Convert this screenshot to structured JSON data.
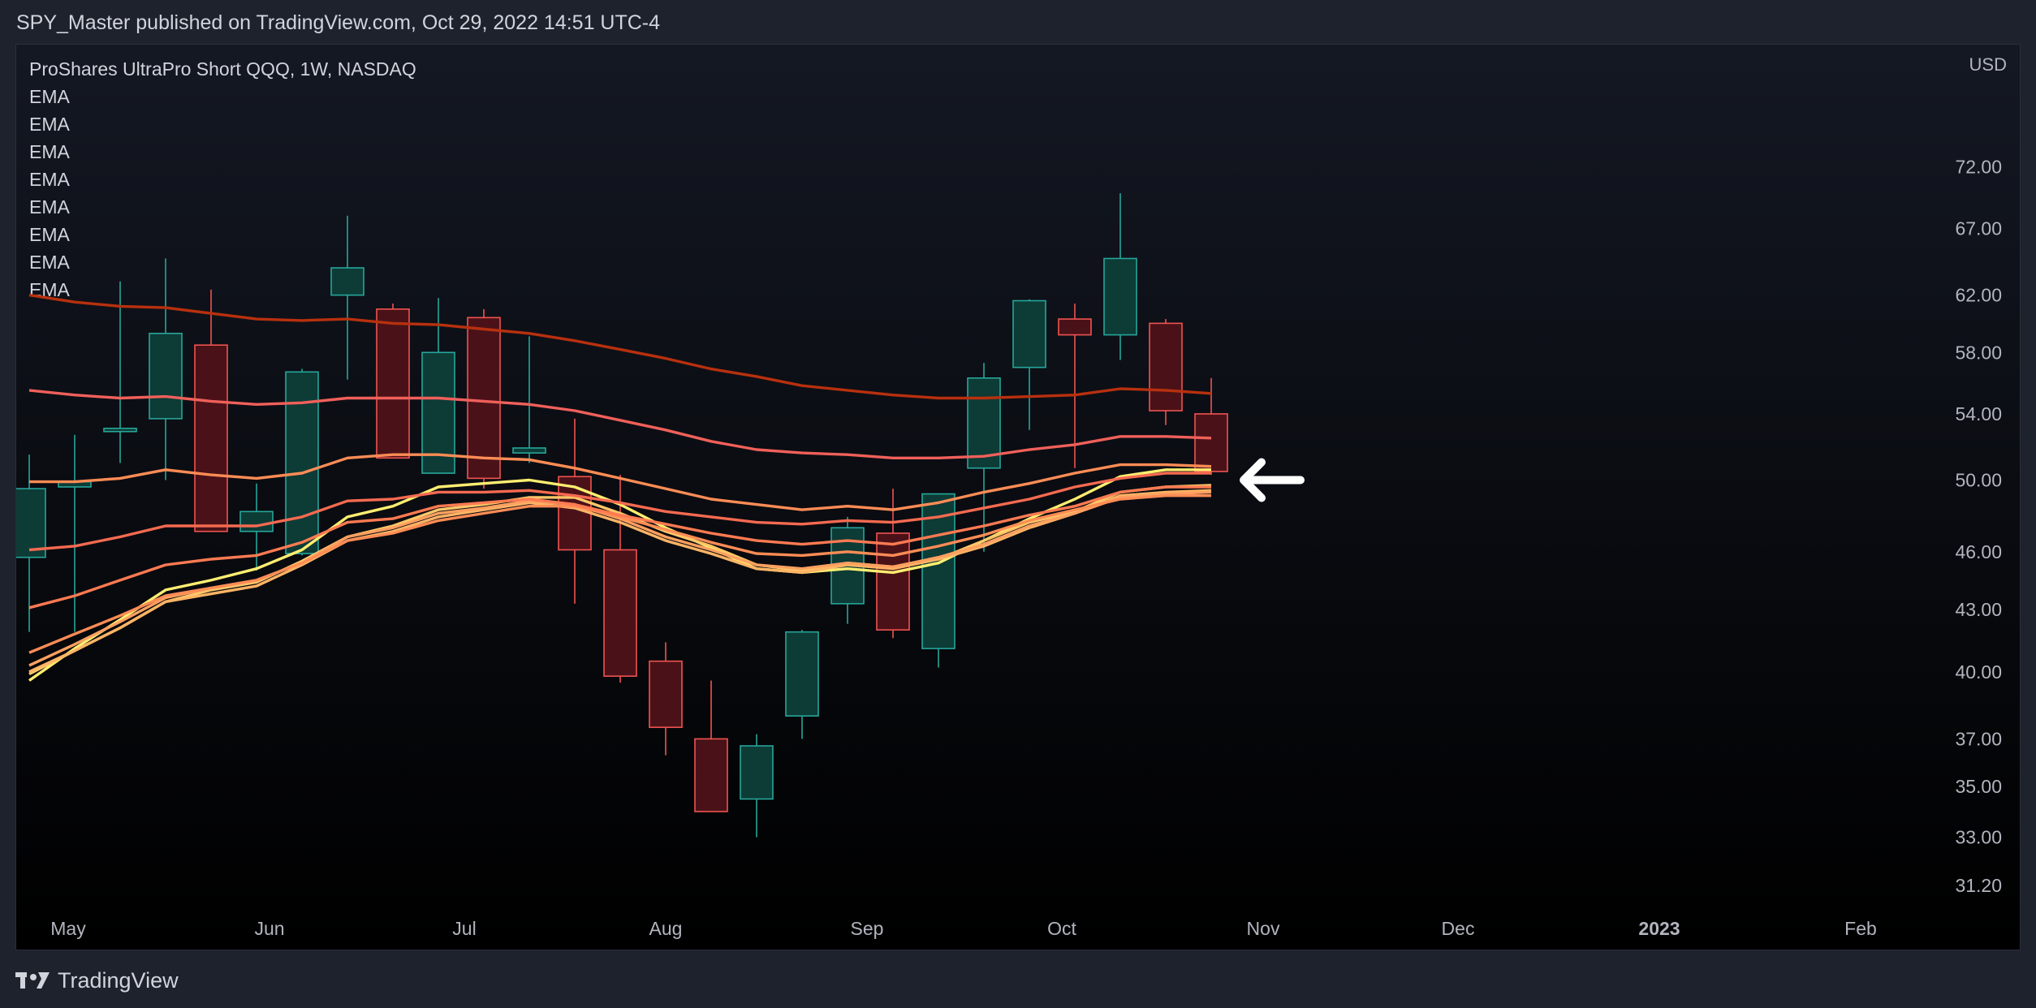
{
  "header": {
    "text": "SPY_Master published on TradingView.com, Oct 29, 2022 14:51 UTC-4"
  },
  "footer": {
    "brand": "TradingView"
  },
  "colors": {
    "up": "#26a69a",
    "up_fill": "#0d3b36",
    "down": "#ef5350",
    "down_fill": "#4a1218",
    "text": "#d1d4dc",
    "axis_text": "#b2b5be",
    "ema": [
      "#ffeb70",
      "#ffc060",
      "#ffb060",
      "#ff9e58",
      "#ff8a50",
      "#ff7550",
      "#f05a4e",
      "#b02a10"
    ]
  },
  "chart_data": {
    "type": "candlestick",
    "symbol_label": "ProShares UltraPro Short QQQ, 1W, NASDAQ",
    "currency": "USD",
    "indicator_labels": [
      "EMA",
      "EMA",
      "EMA",
      "EMA",
      "EMA",
      "EMA",
      "EMA",
      "EMA"
    ],
    "y_ticks": [
      72.0,
      67.0,
      62.0,
      58.0,
      54.0,
      50.0,
      46.0,
      43.0,
      40.0,
      37.0,
      35.0,
      33.0,
      31.2
    ],
    "y_scale": "log",
    "ylim": [
      30.5,
      75.5
    ],
    "x_labels": [
      {
        "label": "May",
        "date": "2022-05-01",
        "bold": false
      },
      {
        "label": "Jun",
        "date": "2022-06-01",
        "bold": false
      },
      {
        "label": "Jul",
        "date": "2022-07-01",
        "bold": false
      },
      {
        "label": "Aug",
        "date": "2022-08-01",
        "bold": false
      },
      {
        "label": "Sep",
        "date": "2022-09-01",
        "bold": false
      },
      {
        "label": "Oct",
        "date": "2022-10-01",
        "bold": false
      },
      {
        "label": "Nov",
        "date": "2022-11-01",
        "bold": false
      },
      {
        "label": "Dec",
        "date": "2022-12-01",
        "bold": false
      },
      {
        "label": "2023",
        "date": "2023-01-01",
        "bold": true
      },
      {
        "label": "Feb",
        "date": "2023-02-01",
        "bold": false
      }
    ],
    "candles": [
      {
        "date": "2022-04-25",
        "o": 45.7,
        "h": 51.5,
        "l": 41.9,
        "c": 49.5
      },
      {
        "date": "2022-05-02",
        "o": 49.6,
        "h": 52.7,
        "l": 41.9,
        "c": 49.9
      },
      {
        "date": "2022-05-09",
        "o": 52.9,
        "h": 63.0,
        "l": 51.0,
        "c": 53.1
      },
      {
        "date": "2022-05-16",
        "o": 53.7,
        "h": 64.7,
        "l": 50.0,
        "c": 59.3
      },
      {
        "date": "2022-05-23",
        "o": 58.5,
        "h": 62.4,
        "l": 47.1,
        "c": 47.1
      },
      {
        "date": "2022-05-30",
        "o": 47.1,
        "h": 49.8,
        "l": 45.0,
        "c": 48.2
      },
      {
        "date": "2022-06-06",
        "o": 45.9,
        "h": 56.9,
        "l": 45.8,
        "c": 56.7
      },
      {
        "date": "2022-06-13",
        "o": 62.0,
        "h": 68.0,
        "l": 56.2,
        "c": 64.0
      },
      {
        "date": "2022-06-20",
        "o": 61.0,
        "h": 61.4,
        "l": 51.3,
        "c": 51.3
      },
      {
        "date": "2022-06-27",
        "o": 50.4,
        "h": 61.8,
        "l": 50.4,
        "c": 58.0
      },
      {
        "date": "2022-07-04",
        "o": 60.4,
        "h": 61.0,
        "l": 49.5,
        "c": 50.1
      },
      {
        "date": "2022-07-11",
        "o": 51.6,
        "h": 59.1,
        "l": 51.0,
        "c": 51.9
      },
      {
        "date": "2022-07-18",
        "o": 50.2,
        "h": 53.7,
        "l": 43.3,
        "c": 46.1
      },
      {
        "date": "2022-07-25",
        "o": 46.1,
        "h": 50.3,
        "l": 39.5,
        "c": 39.8
      },
      {
        "date": "2022-08-01",
        "o": 40.5,
        "h": 41.4,
        "l": 36.3,
        "c": 37.5
      },
      {
        "date": "2022-08-08",
        "o": 37.0,
        "h": 39.6,
        "l": 34.0,
        "c": 34.0
      },
      {
        "date": "2022-08-15",
        "o": 34.5,
        "h": 37.2,
        "l": 33.0,
        "c": 36.7
      },
      {
        "date": "2022-08-22",
        "o": 38.0,
        "h": 42.0,
        "l": 37.0,
        "c": 41.9
      },
      {
        "date": "2022-08-29",
        "o": 43.3,
        "h": 47.9,
        "l": 42.3,
        "c": 47.3
      },
      {
        "date": "2022-09-05",
        "o": 47.0,
        "h": 49.5,
        "l": 41.6,
        "c": 42.0
      },
      {
        "date": "2022-09-12",
        "o": 41.1,
        "h": 49.2,
        "l": 40.2,
        "c": 49.2
      },
      {
        "date": "2022-09-19",
        "o": 50.7,
        "h": 57.3,
        "l": 46.0,
        "c": 56.3
      },
      {
        "date": "2022-09-26",
        "o": 57.0,
        "h": 61.7,
        "l": 53.0,
        "c": 61.6
      },
      {
        "date": "2022-10-03",
        "o": 60.3,
        "h": 61.4,
        "l": 50.7,
        "c": 59.2
      },
      {
        "date": "2022-10-10",
        "o": 59.2,
        "h": 69.8,
        "l": 57.5,
        "c": 64.7
      },
      {
        "date": "2022-10-17",
        "o": 60.0,
        "h": 60.3,
        "l": 53.3,
        "c": 54.2
      },
      {
        "date": "2022-10-24",
        "o": 54.0,
        "h": 56.3,
        "l": 50.3,
        "c": 50.5
      }
    ],
    "ema_lines": [
      {
        "values": [
          39.6,
          41.1,
          42.5,
          44.0,
          44.5,
          45.1,
          46.1,
          47.9,
          48.5,
          49.6,
          49.8,
          50.0,
          49.6,
          48.6,
          47.3,
          46.2,
          45.1,
          44.9,
          45.1,
          44.9,
          45.4,
          46.6,
          47.8,
          48.9,
          50.2,
          50.6,
          50.6
        ]
      },
      {
        "values": [
          39.9,
          41.0,
          42.1,
          43.4,
          44.0,
          44.4,
          45.5,
          46.8,
          47.4,
          48.3,
          48.6,
          49.0,
          49.0,
          48.1,
          47.1,
          46.3,
          45.3,
          45.0,
          45.4,
          45.2,
          45.6,
          46.6,
          47.6,
          48.2,
          49.3,
          49.6,
          49.7
        ]
      },
      {
        "values": [
          40.0,
          41.0,
          42.1,
          43.4,
          43.8,
          44.2,
          45.3,
          46.6,
          47.1,
          47.9,
          48.3,
          48.7,
          48.4,
          47.6,
          46.6,
          45.9,
          45.1,
          44.9,
          45.3,
          45.1,
          45.6,
          46.3,
          47.3,
          48.1,
          49.1,
          49.3,
          49.4
        ]
      },
      {
        "values": [
          40.3,
          41.3,
          42.4,
          43.6,
          44.1,
          44.5,
          45.4,
          46.8,
          47.3,
          48.1,
          48.4,
          48.8,
          48.6,
          47.8,
          46.8,
          46.1,
          45.3,
          45.1,
          45.4,
          45.2,
          45.7,
          46.4,
          47.4,
          48.1,
          49.0,
          49.2,
          49.3
        ]
      },
      {
        "values": [
          40.9,
          41.8,
          42.7,
          43.7,
          44.1,
          44.5,
          45.4,
          46.6,
          47.0,
          47.7,
          48.1,
          48.5,
          48.5,
          47.9,
          47.2,
          46.5,
          45.9,
          45.8,
          46.0,
          45.8,
          46.3,
          46.9,
          47.7,
          48.3,
          48.9,
          49.1,
          49.1
        ]
      },
      {
        "values": [
          43.1,
          43.7,
          44.5,
          45.3,
          45.6,
          45.8,
          46.5,
          47.6,
          47.8,
          48.5,
          48.7,
          48.9,
          48.6,
          48.0,
          47.5,
          47.0,
          46.6,
          46.4,
          46.6,
          46.4,
          46.9,
          47.4,
          48.0,
          48.5,
          49.3,
          49.6,
          49.6
        ]
      },
      {
        "values": [
          46.1,
          46.3,
          46.8,
          47.4,
          47.4,
          47.4,
          47.9,
          48.8,
          48.9,
          49.3,
          49.3,
          49.4,
          49.1,
          48.7,
          48.2,
          47.9,
          47.6,
          47.5,
          47.7,
          47.6,
          47.9,
          48.4,
          48.9,
          49.6,
          50.1,
          50.4,
          50.4
        ]
      },
      {
        "values": [
          49.9,
          49.9,
          50.1,
          50.6,
          50.3,
          50.1,
          50.4,
          51.3,
          51.5,
          51.5,
          51.3,
          51.2,
          50.7,
          50.1,
          49.5,
          48.9,
          48.6,
          48.3,
          48.5,
          48.3,
          48.7,
          49.3,
          49.8,
          50.4,
          50.9,
          50.9,
          50.8
        ]
      },
      {
        "values": [
          55.5,
          55.2,
          55.0,
          55.1,
          54.8,
          54.6,
          54.7,
          55.0,
          55.0,
          55.0,
          54.8,
          54.6,
          54.2,
          53.6,
          53.0,
          52.3,
          51.8,
          51.6,
          51.5,
          51.3,
          51.3,
          51.4,
          51.8,
          52.1,
          52.6,
          52.6,
          52.5
        ]
      },
      {
        "values": [
          62.0,
          61.5,
          61.2,
          61.1,
          60.7,
          60.3,
          60.2,
          60.3,
          60.0,
          59.9,
          59.6,
          59.3,
          58.8,
          58.2,
          57.6,
          56.9,
          56.4,
          55.8,
          55.5,
          55.2,
          55.0,
          55.0,
          55.1,
          55.2,
          55.6,
          55.5,
          55.3
        ]
      }
    ]
  }
}
